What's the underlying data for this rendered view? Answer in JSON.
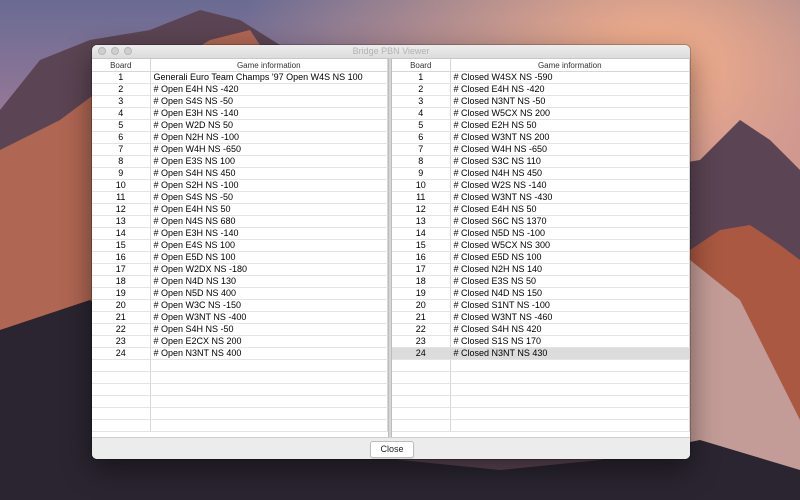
{
  "window": {
    "title": "Bridge PBN Viewer"
  },
  "left_table": {
    "headers": [
      "Board",
      "Game information"
    ],
    "rows": [
      [
        "1",
        "Generali Euro Team Champs '97 Open W4S NS 100"
      ],
      [
        "2",
        "# Open E4H NS -420"
      ],
      [
        "3",
        "# Open S4S NS -50"
      ],
      [
        "4",
        "# Open E3H NS -140"
      ],
      [
        "5",
        "# Open W2D NS 50"
      ],
      [
        "6",
        "# Open N2H NS -100"
      ],
      [
        "7",
        "# Open W4H NS -650"
      ],
      [
        "8",
        "# Open E3S NS 100"
      ],
      [
        "9",
        "# Open S4H NS 450"
      ],
      [
        "10",
        "# Open S2H NS -100"
      ],
      [
        "11",
        "# Open S4S NS -50"
      ],
      [
        "12",
        "# Open E4H NS 50"
      ],
      [
        "13",
        "# Open N4S NS 680"
      ],
      [
        "14",
        "# Open E3H NS -140"
      ],
      [
        "15",
        "# Open E4S NS 100"
      ],
      [
        "16",
        "# Open E5D NS 100"
      ],
      [
        "17",
        "# Open W2DX NS -180"
      ],
      [
        "18",
        "# Open N4D NS 130"
      ],
      [
        "19",
        "# Open N5D NS 400"
      ],
      [
        "20",
        "# Open W3C NS -150"
      ],
      [
        "21",
        "# Open W3NT NS -400"
      ],
      [
        "22",
        "# Open S4H NS -50"
      ],
      [
        "23",
        "# Open E2CX NS 200"
      ],
      [
        "24",
        "# Open N3NT NS 400"
      ]
    ]
  },
  "right_table": {
    "headers": [
      "Board",
      "Game information"
    ],
    "selected_row": "24",
    "rows": [
      [
        "1",
        "# Closed W4SX NS -590"
      ],
      [
        "2",
        "# Closed E4H NS -420"
      ],
      [
        "3",
        "# Closed N3NT NS -50"
      ],
      [
        "4",
        "# Closed W5CX NS 200"
      ],
      [
        "5",
        "# Closed E2H NS 50"
      ],
      [
        "6",
        "# Closed W3NT NS 200"
      ],
      [
        "7",
        "# Closed W4H NS -650"
      ],
      [
        "8",
        "# Closed S3C NS 110"
      ],
      [
        "9",
        "# Closed N4H NS 450"
      ],
      [
        "10",
        "# Closed W2S NS -140"
      ],
      [
        "11",
        "# Closed W3NT NS -430"
      ],
      [
        "12",
        "# Closed E4H NS 50"
      ],
      [
        "13",
        "# Closed S6C NS 1370"
      ],
      [
        "14",
        "# Closed N5D NS -100"
      ],
      [
        "15",
        "# Closed W5CX NS 300"
      ],
      [
        "16",
        "# Closed E5D NS 100"
      ],
      [
        "17",
        "# Closed N2H NS 140"
      ],
      [
        "18",
        "# Closed E3S NS 50"
      ],
      [
        "19",
        "# Closed N4D NS 150"
      ],
      [
        "20",
        "# Closed S1NT NS -100"
      ],
      [
        "21",
        "# Closed W3NT NS -460"
      ],
      [
        "22",
        "# Closed S4H NS 420"
      ],
      [
        "23",
        "# Closed S1S NS 170"
      ],
      [
        "24",
        "# Closed N3NT NS 430"
      ]
    ]
  },
  "footer": {
    "close_label": "Close"
  }
}
